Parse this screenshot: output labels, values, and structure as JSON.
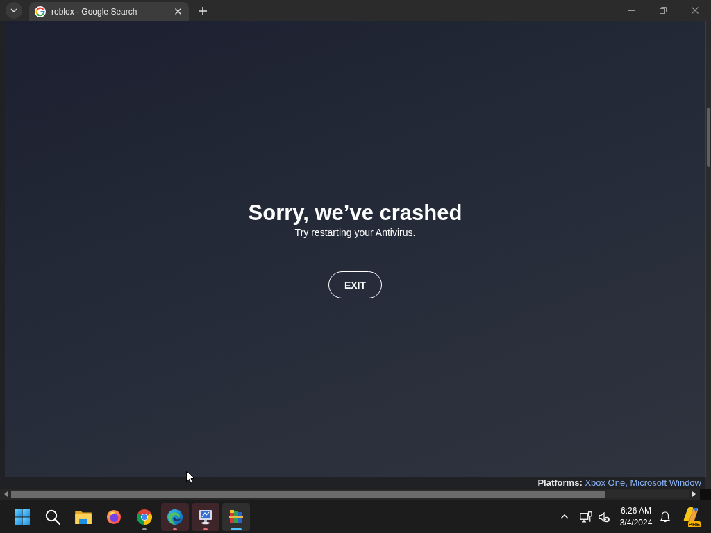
{
  "browser": {
    "tabs": [
      {
        "title": "roblox - Google Search",
        "selected": true
      }
    ],
    "page": {
      "label": "Platforms:",
      "link": "Xbox One, Microsoft Window"
    }
  },
  "crash_dialog": {
    "title": "Sorry, we’ve crashed",
    "message": {
      "prefix": "Try",
      "link": "restarting your Antivirus",
      "suffix": "."
    },
    "button": "EXIT"
  },
  "taskbar": {
    "apps": [
      {
        "kind": "files",
        "running": false,
        "flashing": false,
        "selected": false
      },
      {
        "kind": "firefox",
        "running": false,
        "flashing": false,
        "selected": false
      },
      {
        "kind": "chrome",
        "running": true,
        "flashing": false,
        "selected": false
      },
      {
        "kind": "edge",
        "running": true,
        "flashing": true,
        "selected": false
      },
      {
        "kind": "monitor",
        "running": true,
        "flashing": true,
        "selected": false
      },
      {
        "kind": "archive",
        "running": true,
        "flashing": false,
        "selected": true
      }
    ],
    "tray": {
      "sound_muted": true,
      "time": "6:26 AM",
      "date": "3/4/2024",
      "copilot_badge": "PRE"
    }
  }
}
